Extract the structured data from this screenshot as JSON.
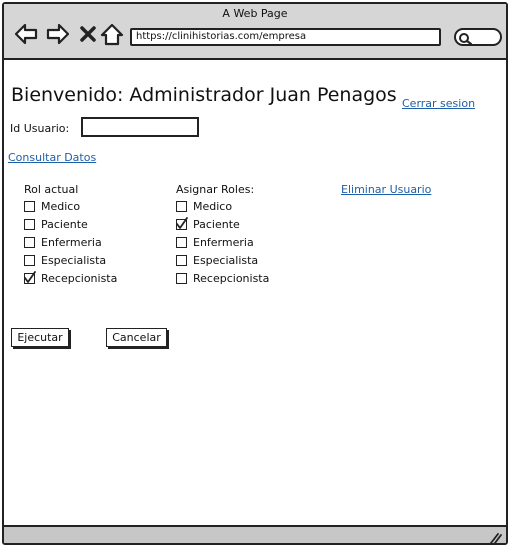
{
  "window": {
    "title": "A Web Page",
    "url": "https://clinihistorias.com/empresa"
  },
  "page": {
    "welcome": "Bienvenido: Administrador Juan Penagos",
    "logout_link": "Cerrar sesion",
    "user_id_label": "Id Usuario:",
    "user_id_value": "",
    "consult_link": "Consultar Datos",
    "delete_link": "Eliminar Usuario"
  },
  "current_roles": {
    "header": "Rol actual",
    "items": [
      {
        "label": "Medico",
        "checked": false
      },
      {
        "label": "Paciente",
        "checked": false
      },
      {
        "label": "Enfermeria",
        "checked": false
      },
      {
        "label": "Especialista",
        "checked": false
      },
      {
        "label": "Recepcionista",
        "checked": true
      }
    ]
  },
  "assign_roles": {
    "header": "Asignar Roles:",
    "items": [
      {
        "label": "Medico",
        "checked": false
      },
      {
        "label": "Paciente",
        "checked": true
      },
      {
        "label": "Enfermeria",
        "checked": false
      },
      {
        "label": "Especialista",
        "checked": false
      },
      {
        "label": "Recepcionista",
        "checked": false
      }
    ]
  },
  "actions": {
    "execute": "Ejecutar",
    "cancel": "Cancelar"
  },
  "icons": [
    "back-arrow-icon",
    "forward-arrow-icon",
    "close-icon",
    "home-icon",
    "search-icon",
    "resize-grip-icon"
  ]
}
